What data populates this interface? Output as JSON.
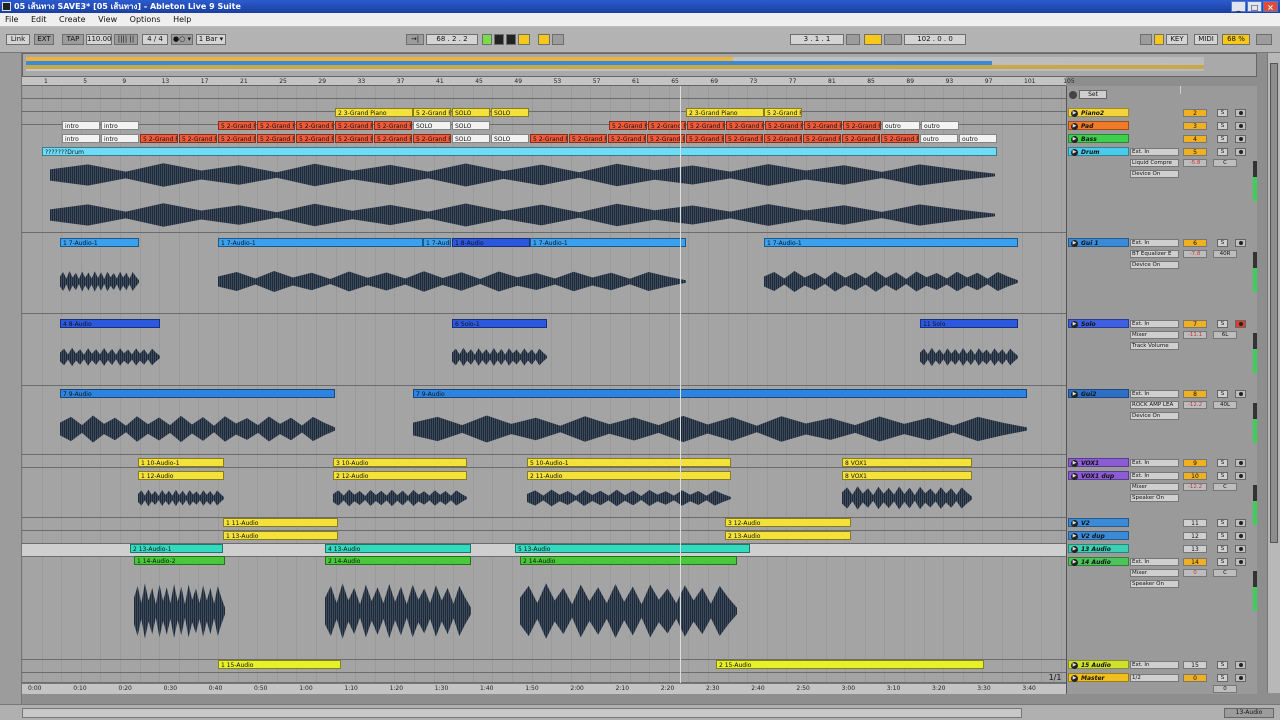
{
  "window": {
    "title": "05 เส้นทาง SAVE3* [05 เส้นทาง] - Ableton Live 9 Suite",
    "minimize": "_",
    "maximize": "□",
    "close": "×"
  },
  "menu": [
    "File",
    "Edit",
    "Create",
    "View",
    "Options",
    "Help"
  ],
  "control": {
    "link": "Link",
    "ext": "EXT",
    "tap": "TAP",
    "tempo": "110.00",
    "beats": "|||| ||",
    "signature": "4 / 4",
    "metro": "●○ ▾",
    "quant": "1 Bar ▾",
    "follow": "→|",
    "position": "68 . 2 . 2",
    "loop_start": "3 . 1 . 1",
    "loop_length": "102 . 0 . 0",
    "key": "KEY",
    "midi": "MIDI",
    "cpu": "68 %"
  },
  "ruler_ticks": [
    "1",
    "5",
    "9",
    "13",
    "17",
    "21",
    "25",
    "29",
    "33",
    "37",
    "41",
    "45",
    "49",
    "53",
    "57",
    "61",
    "65",
    "69",
    "73",
    "77",
    "81",
    "85",
    "89",
    "93",
    "97",
    "101",
    "105"
  ],
  "time_ticks": [
    "0:00",
    "0:10",
    "0:20",
    "0:30",
    "0:40",
    "0:50",
    "1:00",
    "1:10",
    "1:20",
    "1:30",
    "1:40",
    "1:50",
    "2:00",
    "2:10",
    "2:20",
    "2:30",
    "2:40",
    "2:50",
    "3:00",
    "3:10",
    "3:20",
    "3:30",
    "3:40"
  ],
  "set_label": "Set",
  "fraction": "1/1",
  "status": {
    "right": "13-Audio"
  },
  "tracks": [
    {
      "name": "Piano2",
      "color": "#f4d43a",
      "num": "2",
      "io": "",
      "io2": "",
      "vol": "",
      "pan": ""
    },
    {
      "name": "Pad",
      "color": "#ef7a28",
      "num": "3",
      "io": "",
      "io2": "",
      "vol": "",
      "pan": ""
    },
    {
      "name": "Bass",
      "color": "#3fcf4f",
      "num": "4",
      "io": "",
      "io2": "",
      "vol": "",
      "pan": ""
    },
    {
      "name": "Drum",
      "color": "#4bcbea",
      "num": "5",
      "io": "Ext. In",
      "io2": "1",
      "dev": "Liquid Compre",
      "dev2": "Device On",
      "out": "Master",
      "vol": "-5.8",
      "pan": "C"
    },
    {
      "name": "Gui 1",
      "color": "#3a8ad8",
      "num": "6",
      "io": "Ext. In",
      "io2": "1",
      "dev": "BT Equalizer E",
      "dev2": "Device On",
      "out": "Master",
      "vol": "-7.8",
      "pan": "40R"
    },
    {
      "name": "Solo",
      "color": "#3e5fe0",
      "num": "7",
      "io": "Ext. In",
      "io2": "1",
      "dev": "Mixer",
      "dev2": "Track Volume",
      "out": "Master",
      "vol": "-11.1",
      "pan": "6L"
    },
    {
      "name": "Gui2",
      "color": "#2c6fc4",
      "num": "8",
      "io": "Ext. In",
      "io2": "1",
      "dev": "ROCK AMP LEA",
      "dev2": "Device On",
      "out": "Master",
      "vol": "-12.2",
      "pan": "40L"
    },
    {
      "name": "VOX1",
      "color": "#8b5cd6",
      "num": "9",
      "io": "Ext. In",
      "io2": "",
      "vol": "",
      "pan": ""
    },
    {
      "name": "VOX1 dup",
      "color": "#8b5cd6",
      "num": "10",
      "io": "Ext. In",
      "io2": "1",
      "dev": "Mixer",
      "dev2": "Speaker On",
      "out": "Master",
      "vol": "-12.2",
      "pan": "C"
    },
    {
      "name": "V2",
      "color": "#3a8ad8",
      "num": "11",
      "io": "",
      "io2": "",
      "vol": "",
      "pan": ""
    },
    {
      "name": "V2 dup",
      "color": "#3a8ad8",
      "num": "12",
      "io": "",
      "io2": "",
      "vol": "",
      "pan": ""
    },
    {
      "name": "13 Audio",
      "color": "#3dcfb6",
      "num": "13",
      "io": "",
      "io2": "",
      "vol": "",
      "pan": ""
    },
    {
      "name": "14 Audio",
      "color": "#4cc45a",
      "num": "14",
      "io": "Ext. In",
      "io2": "1",
      "dev": "Mixer",
      "dev2": "Speaker On",
      "out": "Master",
      "vol": "0",
      "pan": "C"
    },
    {
      "name": "15 Audio",
      "color": "#cfe02e",
      "num": "15",
      "io": "Ext. In",
      "io2": "",
      "vol": "",
      "pan": ""
    },
    {
      "name": "Master",
      "color": "#f0c020",
      "num": "0",
      "io": "1/2",
      "io2": "",
      "vol": "",
      "pan": "0"
    }
  ],
  "clips": {
    "piano": [
      {
        "text": "2 3-Grand Piano"
      },
      {
        "text": "5 2-Grand Pi"
      },
      {
        "text": "SOLO"
      },
      {
        "text": "SOLO"
      },
      {
        "text": "2 3-Grand Piano"
      },
      {
        "text": "5 2-Grand Pi"
      }
    ],
    "pad": [
      {
        "text": "intro"
      },
      {
        "text": "intro"
      },
      {
        "text": "5 2-Grand P"
      },
      {
        "text": "5 2-Grand P"
      },
      {
        "text": "5 2-Grand P"
      },
      {
        "text": "5 2-Grand P"
      },
      {
        "text": "5 2-Grand P"
      },
      {
        "text": "SOLO"
      },
      {
        "text": "SOLO"
      },
      {
        "text": "5 2-Grand P"
      },
      {
        "text": "5 2-Grand P"
      },
      {
        "text": "5 2-Grand P"
      },
      {
        "text": "5 2-Grand P"
      },
      {
        "text": "5 2-Grand P"
      },
      {
        "text": "5 2-Grand P"
      },
      {
        "text": "5 2-Grand P"
      },
      {
        "text": "outro"
      },
      {
        "text": "outro"
      }
    ],
    "bass": [
      {
        "text": "intro"
      },
      {
        "text": "intro"
      },
      {
        "text": "5 2-Grand P"
      },
      {
        "text": "5 2-Grand P"
      },
      {
        "text": "5 2-Grand P"
      },
      {
        "text": "5 2-Grand P"
      },
      {
        "text": "5 2-Grand P"
      },
      {
        "text": "5 2-Grand P"
      },
      {
        "text": "5 2-Grand P"
      },
      {
        "text": "5 2-Grand P"
      },
      {
        "text": "SOLO"
      },
      {
        "text": "SOLO"
      },
      {
        "text": "5 2-Grand P"
      },
      {
        "text": "5 2-Grand P"
      },
      {
        "text": "5 2-Grand P"
      },
      {
        "text": "5 2-Grand P"
      },
      {
        "text": "5 2-Grand P"
      },
      {
        "text": "5 2-Grand P"
      },
      {
        "text": "5 2-Grand P"
      },
      {
        "text": "5 2-Grand P"
      },
      {
        "text": "5 2-Grand P"
      },
      {
        "text": "5 2-Grand P"
      },
      {
        "text": "outro"
      },
      {
        "text": "outro"
      }
    ],
    "drum": [
      {
        "text": "???????Drum"
      }
    ],
    "gui1": [
      {
        "text": "1 7-Audio-1"
      },
      {
        "text": "1 7-Audio-1"
      },
      {
        "text": "1 7-Audi"
      },
      {
        "text": "1 8-Audio"
      },
      {
        "text": "1 7-Audio-1"
      },
      {
        "text": "1 7-Audio-1"
      }
    ],
    "solo": [
      {
        "text": "4 8-Audio"
      },
      {
        "text": "6 Solo-1"
      },
      {
        "text": "11 Solo"
      }
    ],
    "gui2": [
      {
        "text": "7 9-Audio"
      },
      {
        "text": "7 9-Audio"
      }
    ],
    "vox1": [
      {
        "text": "1 10-Audio-1"
      },
      {
        "text": "3 10-Audio"
      },
      {
        "text": "5 10-Audio-1"
      },
      {
        "text": "8 VOX1"
      }
    ],
    "voxdup": [
      {
        "text": "1 12-Audio"
      },
      {
        "text": "2 12-Audio"
      },
      {
        "text": "2 11-Audio"
      },
      {
        "text": "8 VOX1"
      }
    ],
    "v2": [
      {
        "text": "1 11-Audio"
      },
      {
        "text": "3 12-Audio"
      }
    ],
    "v2dup": [
      {
        "text": "1 13-Audio"
      },
      {
        "text": "2 13-Audio"
      }
    ],
    "a13": [
      {
        "text": "2 13-Audio-1"
      },
      {
        "text": "4 13-Audio"
      },
      {
        "text": "5 13-Audio"
      }
    ],
    "a14": [
      {
        "text": "1 14-Audio-2"
      },
      {
        "text": "2 14-Audio"
      },
      {
        "text": "2 14-Audio"
      }
    ],
    "a15": [
      {
        "text": "1 15-Audio"
      },
      {
        "text": "2 15-Audio"
      }
    ]
  },
  "buttons": {
    "s": "S",
    "in": "In",
    "auto": "Auto",
    "off": "Off"
  },
  "colors": {
    "yellow": "#f4e13a",
    "red": "#ef5a3a",
    "lightblue": "#c7e6f6",
    "white": "#f3f3f3",
    "cyan": "#6fdcf7",
    "blue": "#3aa0f0",
    "darkblue": "#2c58e0",
    "midblue": "#2c84e0",
    "teal": "#35d9bf",
    "green": "#48c83a",
    "lime": "#e8f02a"
  }
}
